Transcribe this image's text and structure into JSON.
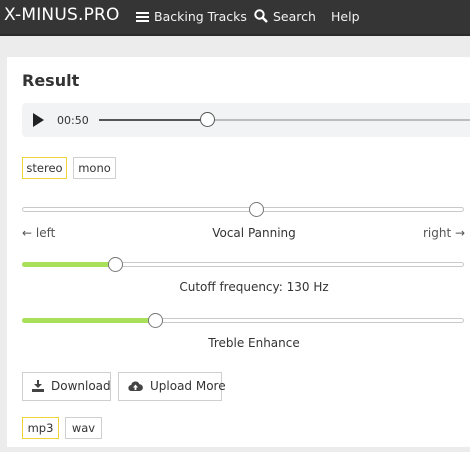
{
  "header": {
    "logo": "X-MINUS.PRO",
    "nav": {
      "backing_tracks": "Backing Tracks",
      "search": "Search",
      "help": "Help"
    }
  },
  "result": {
    "title": "Result",
    "player": {
      "time": "00:50",
      "progress_percent": 29
    },
    "channel_modes": [
      "stereo",
      "mono"
    ],
    "channel_selected": "stereo",
    "panning": {
      "label": "Vocal Panning",
      "left_label": "← left",
      "right_label": "right →",
      "position_percent": 53
    },
    "cutoff": {
      "label": "Cutoff frequency: 130 Hz",
      "value_percent": 21
    },
    "treble": {
      "label": "Treble Enhance",
      "value_percent": 30
    },
    "buttons": {
      "download": "Download",
      "upload_more": "Upload More"
    },
    "formats": [
      "mp3",
      "wav"
    ],
    "format_selected": "mp3"
  },
  "icons": {
    "menu": "menu-icon",
    "search": "search-icon",
    "play": "play-icon",
    "download": "download-icon",
    "upload": "cloud-upload-icon"
  },
  "colors": {
    "header_bg": "#353535",
    "accent_yellow": "#f0d33a",
    "slider_fill": "#a8e05a"
  }
}
